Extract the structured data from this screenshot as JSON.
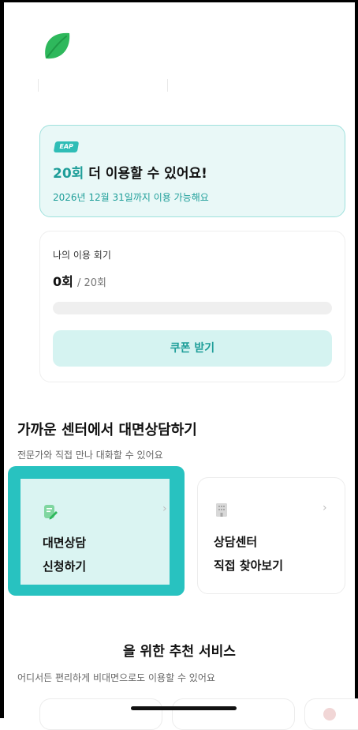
{
  "eap_card": {
    "badge": "EAP",
    "title_count": "20회",
    "title_rest": " 더 이용할 수 있어요!",
    "subtitle": "2026년 12월 31일까지 이용 가능해요"
  },
  "usage_card": {
    "label": "나의 이용 회기",
    "used": "0회",
    "total": "/ 20회",
    "progress_fraction": 0,
    "coupon_button": "쿠폰 받기"
  },
  "offline_section": {
    "title": "가까운 센터에서 대면상담하기",
    "subtitle": "전문가와 직접 만나 대화할 수 있어요",
    "cards": [
      {
        "icon": "memo-pencil-icon",
        "line1": "대면상담",
        "line2": "신청하기"
      },
      {
        "icon": "building-icon",
        "line1": "상담센터",
        "line2": "직접 찾아보기"
      }
    ]
  },
  "recommend_section": {
    "title": "을 위한 추천 서비스",
    "subtitle": "어디서든 편리하게 비대면으로도 이용할 수 있어요"
  },
  "colors": {
    "accent": "#2fbdb6",
    "accent_dark": "#1e9e99",
    "accent_light": "#e9f8f7",
    "highlight": "#28c2c0"
  }
}
